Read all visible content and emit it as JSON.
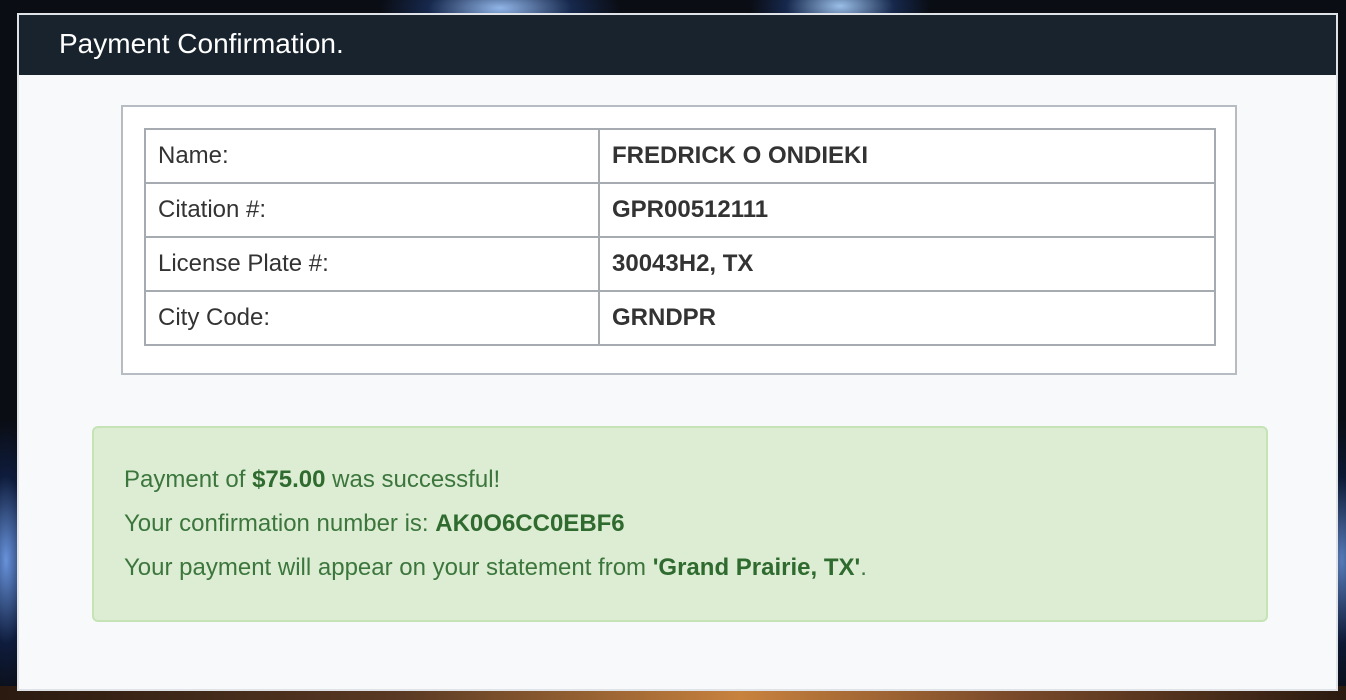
{
  "header": {
    "title": "Payment Confirmation."
  },
  "details": {
    "rows": [
      {
        "label": "Name:",
        "value": "FREDRICK O ONDIEKI"
      },
      {
        "label": "Citation #:",
        "value": "GPR00512111"
      },
      {
        "label": "License Plate #:",
        "value": "30043H2, TX"
      },
      {
        "label": "City Code:",
        "value": "GRNDPR"
      }
    ]
  },
  "alert": {
    "line1_prefix": "Payment of ",
    "amount": "$75.00",
    "line1_suffix": " was successful!",
    "line2_prefix": "Your confirmation number is: ",
    "confirmation_number": "AK0O6CC0EBF6",
    "line3_prefix": "Your payment will appear on your statement from ",
    "statement_name": "'Grand Prairie, TX'",
    "line3_suffix": "."
  },
  "colors": {
    "header_bg": "#18232d",
    "alert_bg": "#dcedd3",
    "alert_text": "#3c763d"
  }
}
